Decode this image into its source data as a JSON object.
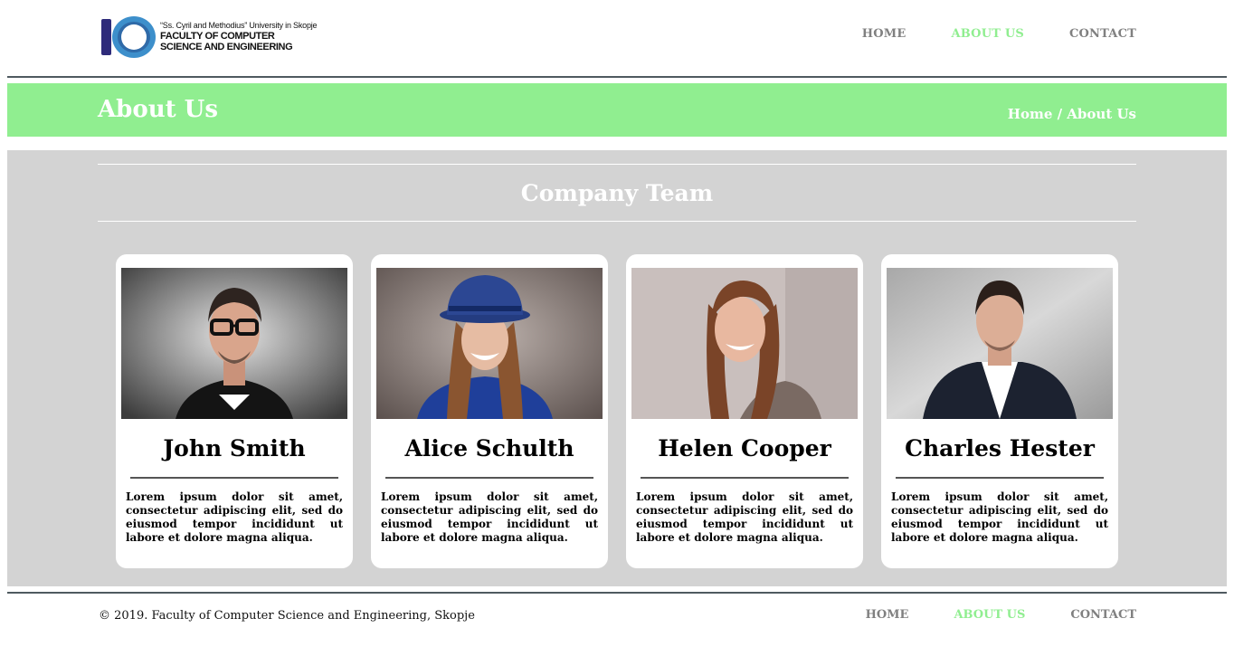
{
  "logo": {
    "line1": "“Ss. Cyril and Methodius” University in Skopje",
    "line2": "FACULTY OF COMPUTER",
    "line3": "SCIENCE AND ENGINEERING"
  },
  "nav": {
    "home": "HOME",
    "about": "ABOUT US",
    "contact": "CONTACT"
  },
  "banner": {
    "title": "About Us",
    "breadcrumb": "Home / About Us"
  },
  "team": {
    "title": "Company Team",
    "members": [
      {
        "name": "John Smith",
        "description": "Lorem ipsum dolor sit amet, consectetur adipiscing elit, sed do eiusmod tempor incididunt ut labore et dolore magna aliqua."
      },
      {
        "name": "Alice Schulth",
        "description": "Lorem ipsum dolor sit amet, consectetur adipiscing elit, sed do eiusmod tempor incididunt ut labore et dolore magna aliqua."
      },
      {
        "name": "Helen Cooper",
        "description": "Lorem ipsum dolor sit amet, consectetur adipiscing elit, sed do eiusmod tempor incididunt ut labore et dolore magna aliqua."
      },
      {
        "name": "Charles Hester",
        "description": "Lorem ipsum dolor sit amet, consectetur adipiscing elit, sed do eiusmod tempor incididunt ut labore et dolore magna aliqua."
      }
    ]
  },
  "footer": {
    "copyright": "© 2019. Faculty of Computer Science and Engineering, Skopje",
    "nav": {
      "home": "HOME",
      "about": "ABOUT US",
      "contact": "CONTACT"
    }
  },
  "colors": {
    "accent": "#90ee90",
    "nav_gray": "#808080",
    "section_bg": "#d3d3d3"
  }
}
